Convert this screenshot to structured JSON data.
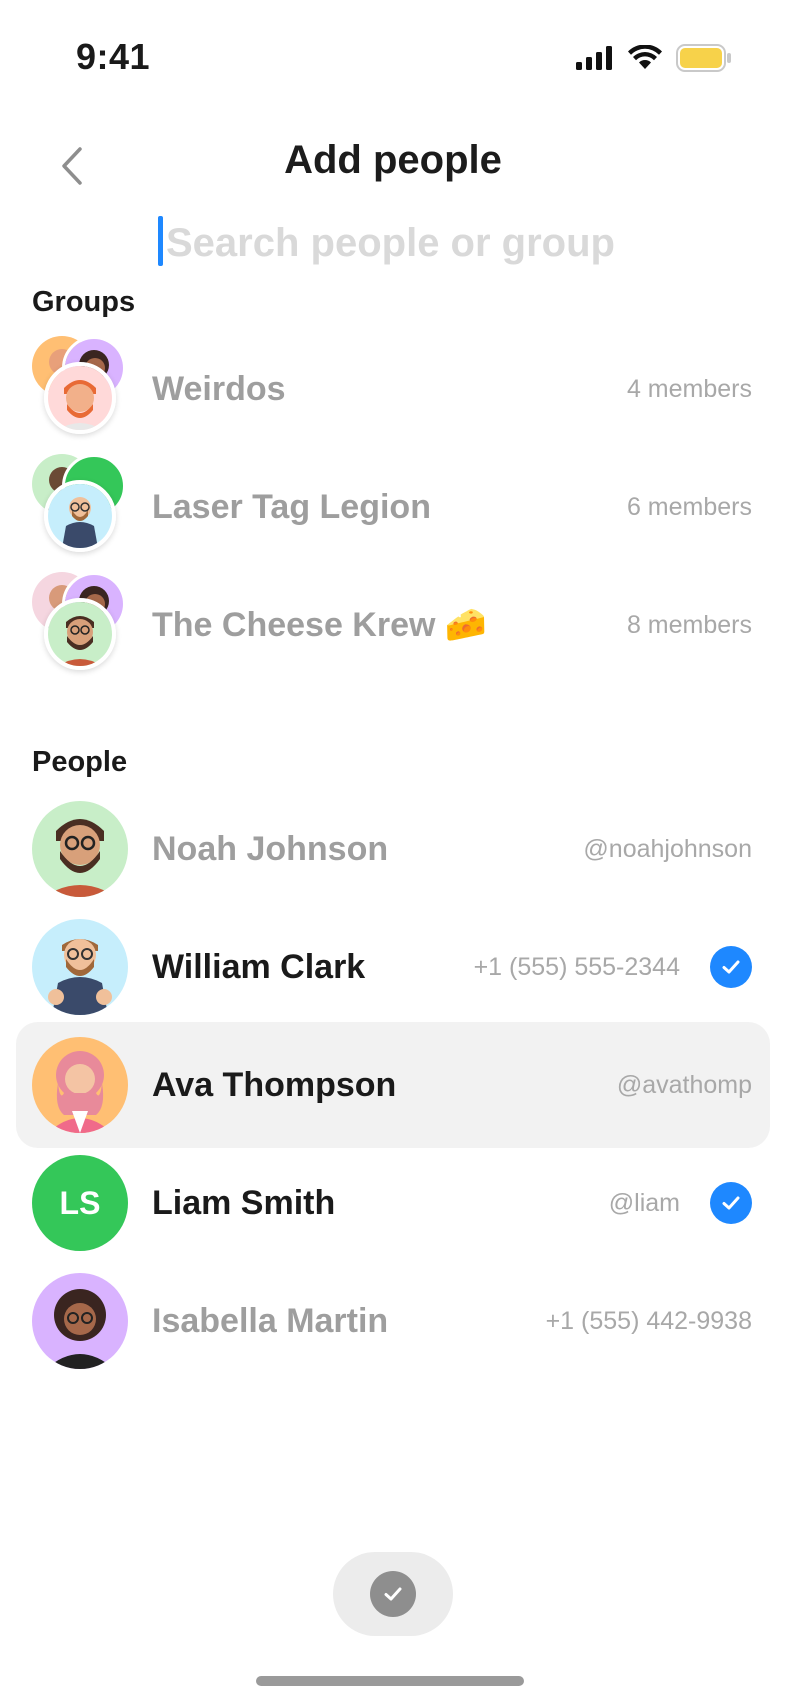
{
  "status_bar": {
    "time": "9:41",
    "battery_color": "#f7d24a"
  },
  "header": {
    "title": "Add people"
  },
  "search": {
    "value": "",
    "placeholder": "Search people or group"
  },
  "groups_section": {
    "title": "Groups",
    "items": [
      {
        "name": "Weirdos",
        "meta": "4 members",
        "emoji": ""
      },
      {
        "name": "Laser Tag Legion",
        "meta": "6 members",
        "emoji": ""
      },
      {
        "name": "The Cheese Krew",
        "meta": "8 members",
        "emoji": "🧀"
      }
    ]
  },
  "people_section": {
    "title": "People",
    "items": [
      {
        "name": "Noah Johnson",
        "meta": "@noahjohnson",
        "selected": false
      },
      {
        "name": "William Clark",
        "meta": "+1 (555) 555-2344",
        "selected": true
      },
      {
        "name": "Ava Thompson",
        "meta": "@avathomp",
        "selected": false
      },
      {
        "name": "Liam Smith",
        "meta": "@liam",
        "selected": true,
        "initials": "LS"
      },
      {
        "name": "Isabella Martin",
        "meta": "+1 (555) 442-9938",
        "selected": false
      }
    ]
  },
  "colors": {
    "accent": "#1e88ff",
    "initials_avatar": "#34c759"
  }
}
